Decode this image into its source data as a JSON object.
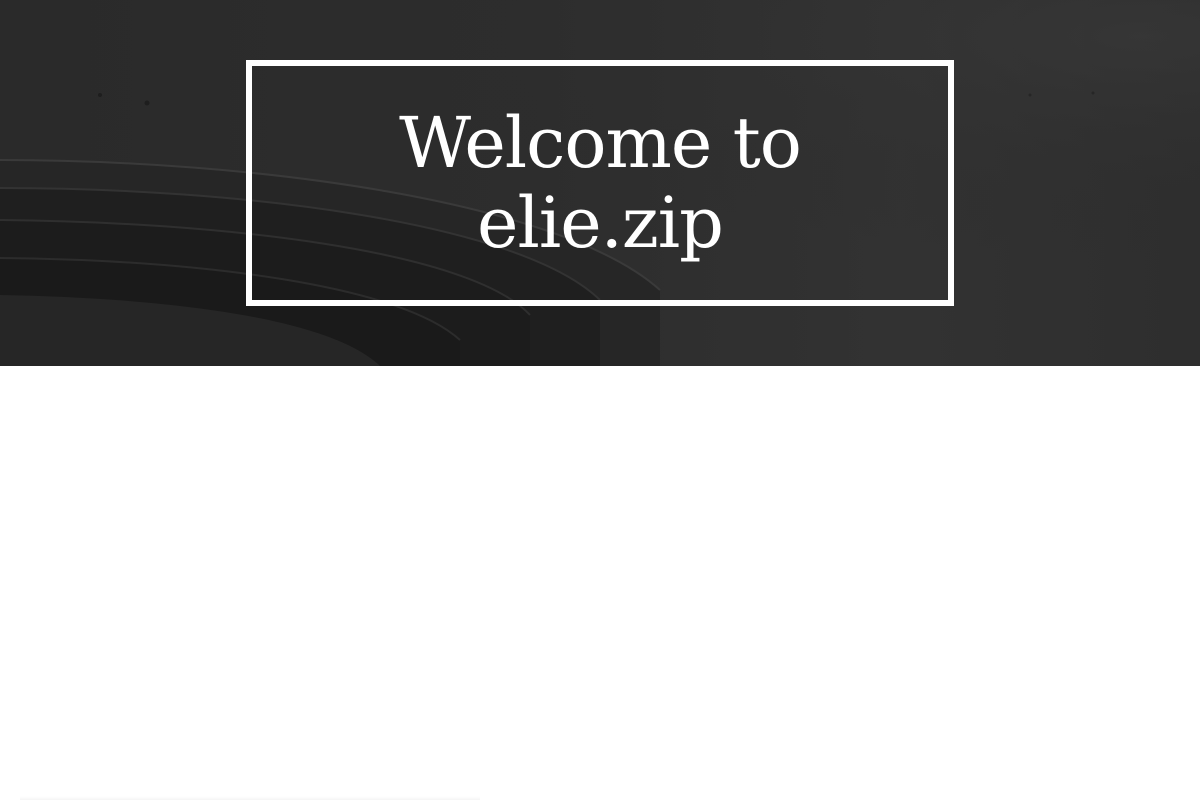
{
  "hero": {
    "title": "Welcome to elie.zip",
    "background_color": "#2d2d2d",
    "text_color": "#ffffff"
  }
}
